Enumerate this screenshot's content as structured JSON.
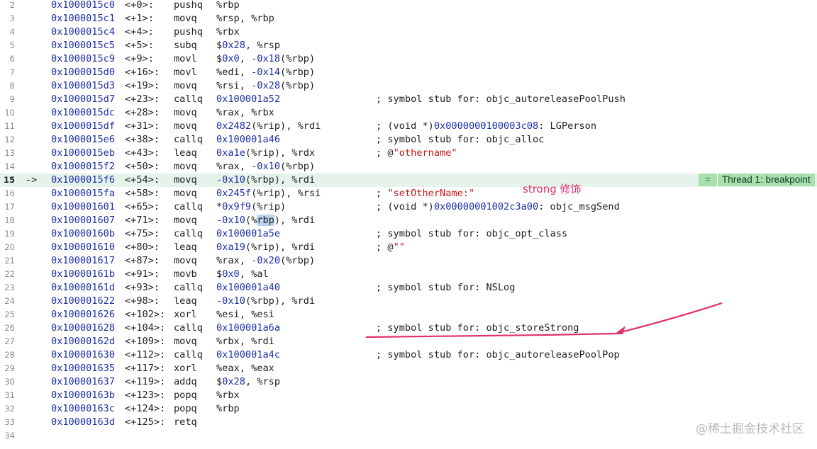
{
  "current_line_index": 13,
  "rows": [
    {
      "ln": "2",
      "addr": "0x1000015c0",
      "off": "<+0>:",
      "mn": "pushq",
      "ops": [
        "%rbp"
      ],
      "cm": []
    },
    {
      "ln": "3",
      "addr": "0x1000015c1",
      "off": "<+1>:",
      "mn": "movq",
      "ops": [
        "%rsp, %rbp"
      ],
      "cm": []
    },
    {
      "ln": "4",
      "addr": "0x1000015c4",
      "off": "<+4>:",
      "mn": "pushq",
      "ops": [
        "%rbx"
      ],
      "cm": []
    },
    {
      "ln": "5",
      "addr": "0x1000015c5",
      "off": "<+5>:",
      "mn": "subq",
      "ops": [
        "$",
        {
          "n": "0x28"
        },
        ", %rsp"
      ],
      "cm": []
    },
    {
      "ln": "6",
      "addr": "0x1000015c9",
      "off": "<+9>:",
      "mn": "movl",
      "ops": [
        "$",
        {
          "n": "0x0"
        },
        ", ",
        {
          "n": "-0x18"
        },
        "(%rbp)"
      ],
      "cm": []
    },
    {
      "ln": "7",
      "addr": "0x1000015d0",
      "off": "<+16>:",
      "mn": "movl",
      "ops": [
        "%edi, ",
        {
          "n": "-0x14"
        },
        "(%rbp)"
      ],
      "cm": []
    },
    {
      "ln": "8",
      "addr": "0x1000015d3",
      "off": "<+19>:",
      "mn": "movq",
      "ops": [
        "%rsi, ",
        {
          "n": "-0x28"
        },
        "(%rbp)"
      ],
      "cm": []
    },
    {
      "ln": "9",
      "addr": "0x1000015d7",
      "off": "<+23>:",
      "mn": "callq",
      "ops": [
        {
          "n": "0x100001a52"
        }
      ],
      "cm": [
        "; symbol stub for: objc_autoreleasePoolPush"
      ]
    },
    {
      "ln": "10",
      "addr": "0x1000015dc",
      "off": "<+28>:",
      "mn": "movq",
      "ops": [
        "%rax, %rbx"
      ],
      "cm": []
    },
    {
      "ln": "11",
      "addr": "0x1000015df",
      "off": "<+31>:",
      "mn": "movq",
      "ops": [
        {
          "n": "0x2482"
        },
        "(%rip), %rdi"
      ],
      "cm": [
        "; (void *)",
        {
          "n": "0x0000000100003c08"
        },
        ": LGPerson"
      ]
    },
    {
      "ln": "12",
      "addr": "0x1000015e6",
      "off": "<+38>:",
      "mn": "callq",
      "ops": [
        {
          "n": "0x100001a46"
        }
      ],
      "cm": [
        "; symbol stub for: objc_alloc"
      ]
    },
    {
      "ln": "13",
      "addr": "0x1000015eb",
      "off": "<+43>:",
      "mn": "leaq",
      "ops": [
        {
          "n": "0xa1e"
        },
        "(%rip), %rdx"
      ],
      "cm": [
        "; @",
        {
          "s": "\"othername\""
        }
      ]
    },
    {
      "ln": "14",
      "addr": "0x1000015f2",
      "off": "<+50>:",
      "mn": "movq",
      "ops": [
        "%rax, ",
        {
          "n": "-0x10"
        },
        "(%rbp)"
      ],
      "cm": []
    },
    {
      "ln": "15",
      "marker": "->",
      "addr": "0x1000015f6",
      "off": "<+54>:",
      "mn": "movq",
      "ops": [
        {
          "n": "-0x10"
        },
        "(%rbp), %rdi"
      ],
      "cm": []
    },
    {
      "ln": "16",
      "addr": "0x1000015fa",
      "off": "<+58>:",
      "mn": "movq",
      "ops": [
        {
          "n": "0x245f"
        },
        "(%rip), %rsi"
      ],
      "cm": [
        "; ",
        {
          "s": "\"setOtherName:\""
        }
      ]
    },
    {
      "ln": "17",
      "addr": "0x100001601",
      "off": "<+65>:",
      "mn": "callq",
      "ops": [
        "*",
        {
          "n": "0x9f9"
        },
        "(%rip)"
      ],
      "cm": [
        "; (void *)",
        {
          "n": "0x00000001002c3a00"
        },
        ": objc_msgSend"
      ]
    },
    {
      "ln": "18",
      "addr": "0x100001607",
      "off": "<+71>:",
      "mn": "movq",
      "ops": [
        {
          "n": "-0x10"
        },
        "(%",
        {
          "h": "rbp"
        },
        "), %rdi"
      ],
      "cm": []
    },
    {
      "ln": "19",
      "addr": "0x10000160b",
      "off": "<+75>:",
      "mn": "callq",
      "ops": [
        {
          "n": "0x100001a5e"
        }
      ],
      "cm": [
        "; symbol stub for: objc_opt_class"
      ]
    },
    {
      "ln": "20",
      "addr": "0x100001610",
      "off": "<+80>:",
      "mn": "leaq",
      "ops": [
        {
          "n": "0xa19"
        },
        "(%rip), %rdi"
      ],
      "cm": [
        "; @",
        {
          "s": "\"\""
        }
      ]
    },
    {
      "ln": "21",
      "addr": "0x100001617",
      "off": "<+87>:",
      "mn": "movq",
      "ops": [
        "%rax, ",
        {
          "n": "-0x20"
        },
        "(%rbp)"
      ],
      "cm": []
    },
    {
      "ln": "22",
      "addr": "0x10000161b",
      "off": "<+91>:",
      "mn": "movb",
      "ops": [
        "$",
        {
          "n": "0x0"
        },
        ", %al"
      ],
      "cm": []
    },
    {
      "ln": "23",
      "addr": "0x10000161d",
      "off": "<+93>:",
      "mn": "callq",
      "ops": [
        {
          "n": "0x100001a40"
        }
      ],
      "cm": [
        "; symbol stub for: NSLog"
      ]
    },
    {
      "ln": "24",
      "addr": "0x100001622",
      "off": "<+98>:",
      "mn": "leaq",
      "ops": [
        {
          "n": "-0x10"
        },
        "(%rbp), %rdi"
      ],
      "cm": []
    },
    {
      "ln": "25",
      "addr": "0x100001626",
      "off": "<+102>:",
      "mn": "xorl",
      "ops": [
        "%esi, %esi"
      ],
      "cm": []
    },
    {
      "ln": "26",
      "addr": "0x100001628",
      "off": "<+104>:",
      "mn": "callq",
      "ops": [
        {
          "n": "0x100001a6a"
        }
      ],
      "cm": [
        "; symbol stub for: objc_storeStrong"
      ]
    },
    {
      "ln": "27",
      "addr": "0x10000162d",
      "off": "<+109>:",
      "mn": "movq",
      "ops": [
        "%rbx, %rdi"
      ],
      "cm": []
    },
    {
      "ln": "28",
      "addr": "0x100001630",
      "off": "<+112>:",
      "mn": "callq",
      "ops": [
        {
          "n": "0x100001a4c"
        }
      ],
      "cm": [
        "; symbol stub for: objc_autoreleasePoolPop"
      ]
    },
    {
      "ln": "29",
      "addr": "0x100001635",
      "off": "<+117>:",
      "mn": "xorl",
      "ops": [
        "%eax, %eax"
      ],
      "cm": []
    },
    {
      "ln": "30",
      "addr": "0x100001637",
      "off": "<+119>:",
      "mn": "addq",
      "ops": [
        "$",
        {
          "n": "0x28"
        },
        ", %rsp"
      ],
      "cm": []
    },
    {
      "ln": "31",
      "addr": "0x10000163b",
      "off": "<+123>:",
      "mn": "popq",
      "ops": [
        "%rbx"
      ],
      "cm": []
    },
    {
      "ln": "32",
      "addr": "0x10000163c",
      "off": "<+124>:",
      "mn": "popq",
      "ops": [
        "%rbp"
      ],
      "cm": []
    },
    {
      "ln": "33",
      "addr": "0x10000163d",
      "off": "<+125>:",
      "mn": "retq",
      "ops": [],
      "cm": []
    },
    {
      "ln": "34",
      "addr": "",
      "off": "",
      "mn": "",
      "ops": [],
      "cm": []
    }
  ],
  "thread_badge": {
    "icon": "=",
    "label": "Thread 1: breakpoint"
  },
  "annotation": {
    "text": "strong 修饰",
    "color": "#e0306e"
  },
  "watermark": "@稀土掘金技术社区",
  "colors": {
    "address": "#1c2fa8",
    "number": "#1c2fa8",
    "string": "#c41a16",
    "current_line_bg": "#e5f3ea",
    "badge_bg": "#a8e0b0",
    "annotation": "#e0306e"
  }
}
